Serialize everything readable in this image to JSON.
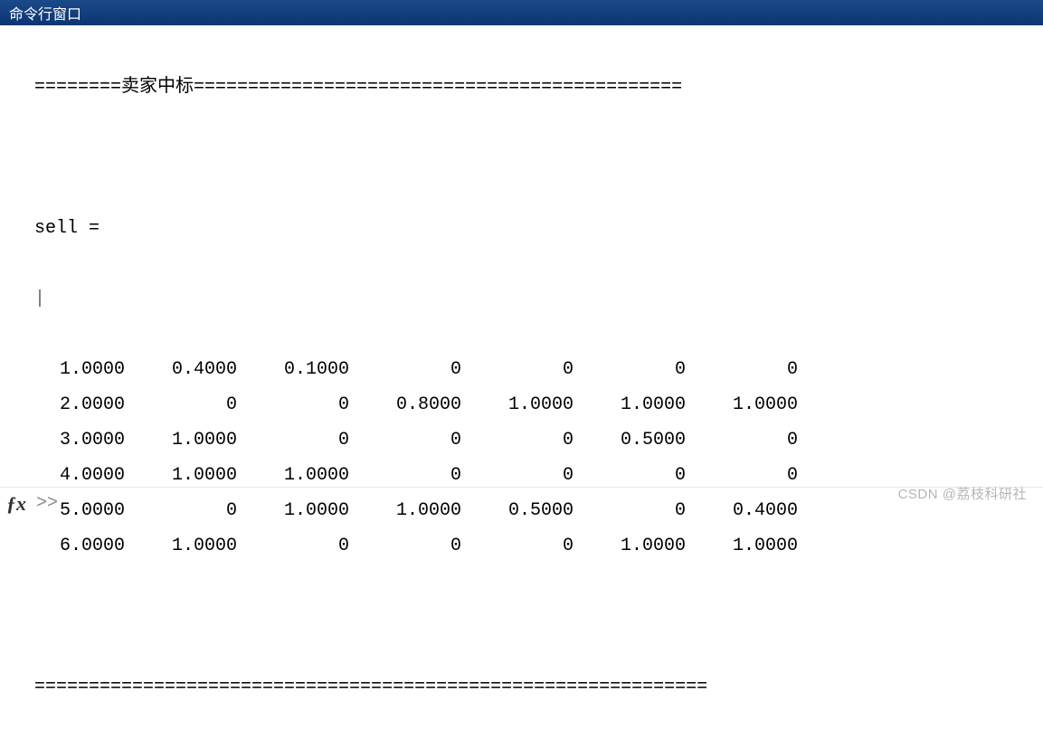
{
  "title": "命令行窗口",
  "header_prefix": "========",
  "header_label": "卖家中标",
  "header_suffix": "=============================================",
  "var_name": "sell =",
  "rows": [
    [
      "1.0000",
      "0.4000",
      "0.1000",
      "0",
      "0",
      "0",
      "0"
    ],
    [
      "2.0000",
      "0",
      "0",
      "0.8000",
      "1.0000",
      "1.0000",
      "1.0000"
    ],
    [
      "3.0000",
      "1.0000",
      "0",
      "0",
      "0",
      "0.5000",
      "0"
    ],
    [
      "4.0000",
      "1.0000",
      "1.0000",
      "0",
      "0",
      "0",
      "0"
    ],
    [
      "5.0000",
      "0",
      "1.0000",
      "1.0000",
      "0.5000",
      "0",
      "0.4000"
    ],
    [
      "6.0000",
      "1.0000",
      "0",
      "0",
      "0",
      "1.0000",
      "1.0000"
    ]
  ],
  "footer_sep": "==============================================================",
  "prompt": ">>",
  "watermark": "CSDN @荔枝科研社",
  "cursor": "|"
}
